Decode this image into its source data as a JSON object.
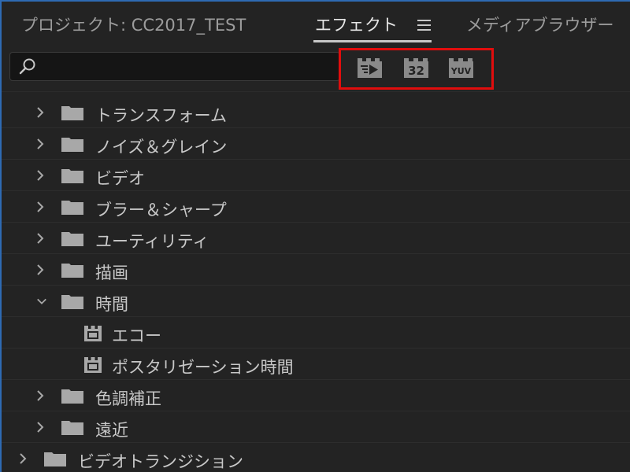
{
  "tabs": {
    "project": "プロジェクト: CC2017_TEST",
    "effects": "エフェクト",
    "media_browser": "メディアブラウザー"
  },
  "search": {
    "value": "",
    "placeholder": ""
  },
  "filter_buttons": {
    "accelerated": "accelerated-effects-icon",
    "bit32": "32",
    "yuv": "YUV"
  },
  "tree": {
    "rows": [
      {
        "label": "トランスフォーム",
        "type": "folder",
        "expanded": false
      },
      {
        "label": "ノイズ＆グレイン",
        "type": "folder",
        "expanded": false
      },
      {
        "label": "ビデオ",
        "type": "folder",
        "expanded": false
      },
      {
        "label": "ブラー＆シャープ",
        "type": "folder",
        "expanded": false
      },
      {
        "label": "ユーティリティ",
        "type": "folder",
        "expanded": false
      },
      {
        "label": "描画",
        "type": "folder",
        "expanded": false
      },
      {
        "label": "時間",
        "type": "folder",
        "expanded": true
      },
      {
        "label": "エコー",
        "type": "effect"
      },
      {
        "label": "ポスタリゼーション時間",
        "type": "effect"
      },
      {
        "label": "色調補正",
        "type": "folder",
        "expanded": false
      },
      {
        "label": "遠近",
        "type": "folder",
        "expanded": false
      },
      {
        "label": "ビデオトランジション",
        "type": "folder",
        "expanded": false
      }
    ]
  },
  "colors": {
    "highlight": "#e10d0d",
    "panel_border": "#2e6ab3",
    "background": "#232323"
  }
}
